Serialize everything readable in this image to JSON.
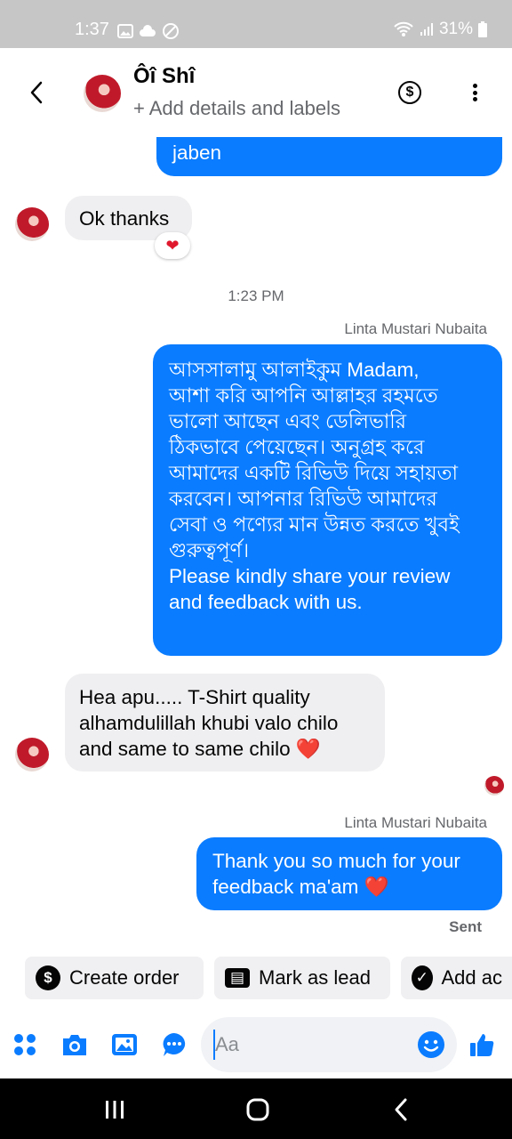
{
  "status_bar": {
    "time": "1:37",
    "battery": "31%"
  },
  "header": {
    "contact_name": "Ôî Shî",
    "subtitle": "+ Add details and labels",
    "dollar_symbol": "$"
  },
  "messages": {
    "partial_out_text": "jaben",
    "in_1_text": "Ok thanks",
    "in_1_reaction": "❤",
    "timestamp_1": "1:23 PM",
    "sender_1": "Linta Mustari Nubaita",
    "out_2_lines": [
      "আসসালামু আলাইকুম Madam,",
      "আশা করি আপনি আল্লাহর রহমতে",
      "ভালো আছেন এবং ডেলিভারি",
      "ঠিকভাবে পেয়েছেন। অনুগ্রহ করে",
      "আমাদের একটি রিভিউ দিয়ে সহায়তা",
      "করবেন। আপনার রিভিউ আমাদের",
      "সেবা ও পণ্যের মান উন্নত করতে খুবই",
      "গুরুত্বপূর্ণ।",
      "Please kindly share your review",
      "and feedback with us."
    ],
    "in_2_lines": [
      "Hea apu..... T-Shirt quality",
      "alhamdulillah khubi valo chilo",
      "and same to same chilo"
    ],
    "in_2_emoji": "❤️",
    "sender_2": "Linta Mustari Nubaita",
    "out_3_lines": [
      "Thank you so much for your",
      "feedback ma'am"
    ],
    "out_3_emoji": "❤️",
    "sent_status": "Sent"
  },
  "quick_actions": [
    {
      "label": "Create order",
      "icon": "dollar-circle-icon",
      "glyph": "$"
    },
    {
      "label": "Mark as lead",
      "icon": "contact-card-icon",
      "glyph": "▤"
    },
    {
      "label": "Add ac",
      "icon": "check-circle-icon",
      "glyph": "✓"
    }
  ],
  "composer": {
    "placeholder": "Aa"
  },
  "colors": {
    "accent": "#0a7cff",
    "incoming_bubble": "#efeff1",
    "heart": "#e0182d"
  }
}
